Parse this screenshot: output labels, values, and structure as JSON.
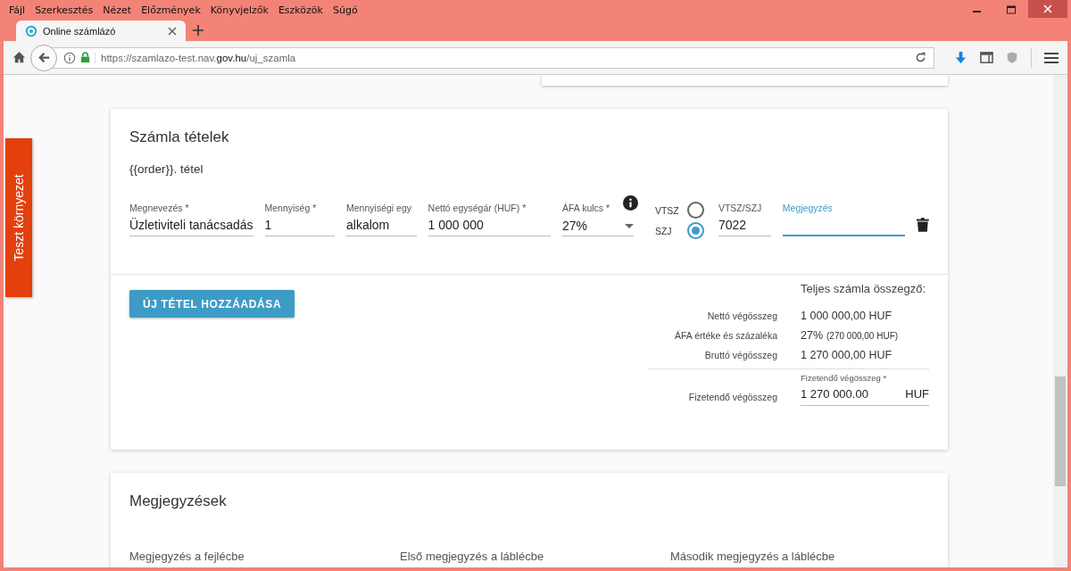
{
  "window": {
    "menu": [
      {
        "label": "Fájl"
      },
      {
        "label": "Szerkesztés"
      },
      {
        "label": "Nézet"
      },
      {
        "label": "Előzmények"
      },
      {
        "label": "Könyvjelzők"
      },
      {
        "label": "Eszközök"
      },
      {
        "label": "Súgó"
      }
    ],
    "tabs": [
      {
        "label": "Online számlázó",
        "selected": true
      }
    ],
    "address": "https://szamlazo-test.nav.**gov.hu**/uj_szamla"
  },
  "side_tab": "Teszt környezet",
  "items_card": {
    "title": "Számla tételek",
    "item_heading": "{{order}}. tétel",
    "fields": [
      {
        "kind": "text",
        "label": "Megnevezés *",
        "value": "Üzletiviteli tanácsadás"
      },
      {
        "kind": "text",
        "label": "Mennyiség *",
        "value": "1"
      },
      {
        "kind": "text",
        "label": "Mennyiségi egy",
        "value": "alkalom"
      },
      {
        "kind": "text",
        "label": "Nettó egységár (HUF) *",
        "value": "1 000 000"
      },
      {
        "kind": "select",
        "label": "ÁFA kulcs *",
        "value": "27%"
      },
      {
        "kind": "radio",
        "options": [
          {
            "label": "VTSZ",
            "selected": false
          },
          {
            "label": "SZJ",
            "selected": true
          }
        ]
      },
      {
        "kind": "text",
        "label": "VTSZ/SZJ",
        "value": "7022"
      },
      {
        "kind": "text",
        "label": "Megjegyzés",
        "focused": true
      }
    ],
    "add_button": "ÚJ TÉTEL HOZZÁADÁSA",
    "summary": {
      "title": "Teljes számla összegző:",
      "rows": [
        {
          "label": "Nettó végösszeg",
          "value": "1 000 000,00 HUF"
        },
        {
          "label": "ÁFA értéke és százaléka",
          "value": "27%",
          "note": "(270 000,00 HUF)"
        },
        {
          "label": "Bruttó végösszeg",
          "value": "1 270 000,00 HUF"
        }
      ],
      "payable": {
        "label": "Fizetendő végösszeg",
        "field_label": "Fizetendő végösszeg *",
        "value": "1 270 000.00",
        "suffix": "HUF"
      }
    }
  },
  "notes_card": {
    "title": "Megjegyzések",
    "fields": [
      "Megjegyzés a fejlécbe",
      "Első megjegyzés a láblécbe",
      "Második megjegyzés a láblécbe"
    ]
  }
}
